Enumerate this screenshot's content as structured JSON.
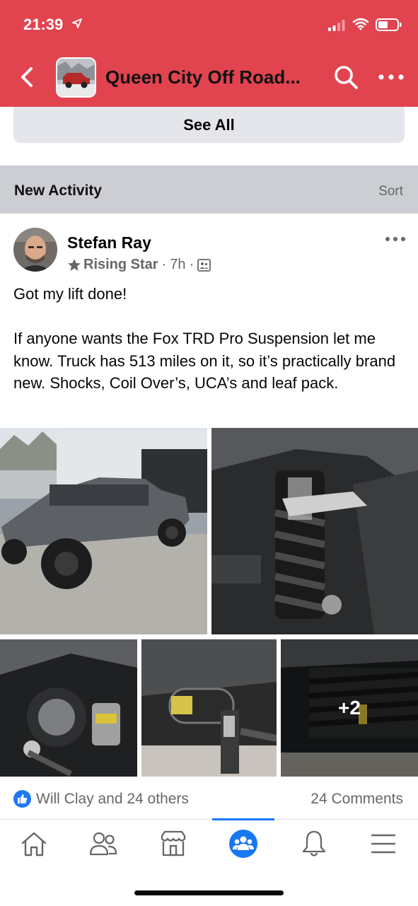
{
  "status_bar": {
    "time": "21:39"
  },
  "header": {
    "group_title": "Queen City Off Road..."
  },
  "see_all": {
    "label": "See All"
  },
  "section": {
    "title": "New Activity",
    "sort_label": "Sort"
  },
  "post": {
    "author": "Stefan Ray",
    "badge": "Rising Star",
    "time": "7h",
    "separator": "·",
    "text_line1": "Got my lift done!",
    "text_line2": "If anyone wants the Fox TRD Pro Suspension let me know. Truck has 513 miles on it, so it’s practically brand new. Shocks, Coil Over’s, UCA’s and leaf pack.",
    "more_photos_label": "+2",
    "reactions_text": "Will Clay and 24 others",
    "comments_text": "24 Comments"
  },
  "colors": {
    "header_bg": "#e1434f",
    "accent_blue": "#1877f2",
    "section_bg": "#ccced3",
    "see_all_bg": "#e4e6eb"
  },
  "icons": {
    "status": [
      "location-arrow-icon",
      "signal-icon",
      "wifi-icon",
      "battery-icon"
    ],
    "header": [
      "back-chevron-icon",
      "search-icon",
      "more-icon"
    ],
    "tabs": [
      "home-icon",
      "friends-icon",
      "marketplace-icon",
      "groups-icon",
      "bell-icon",
      "menu-icon"
    ],
    "active_tab": "groups-icon"
  }
}
